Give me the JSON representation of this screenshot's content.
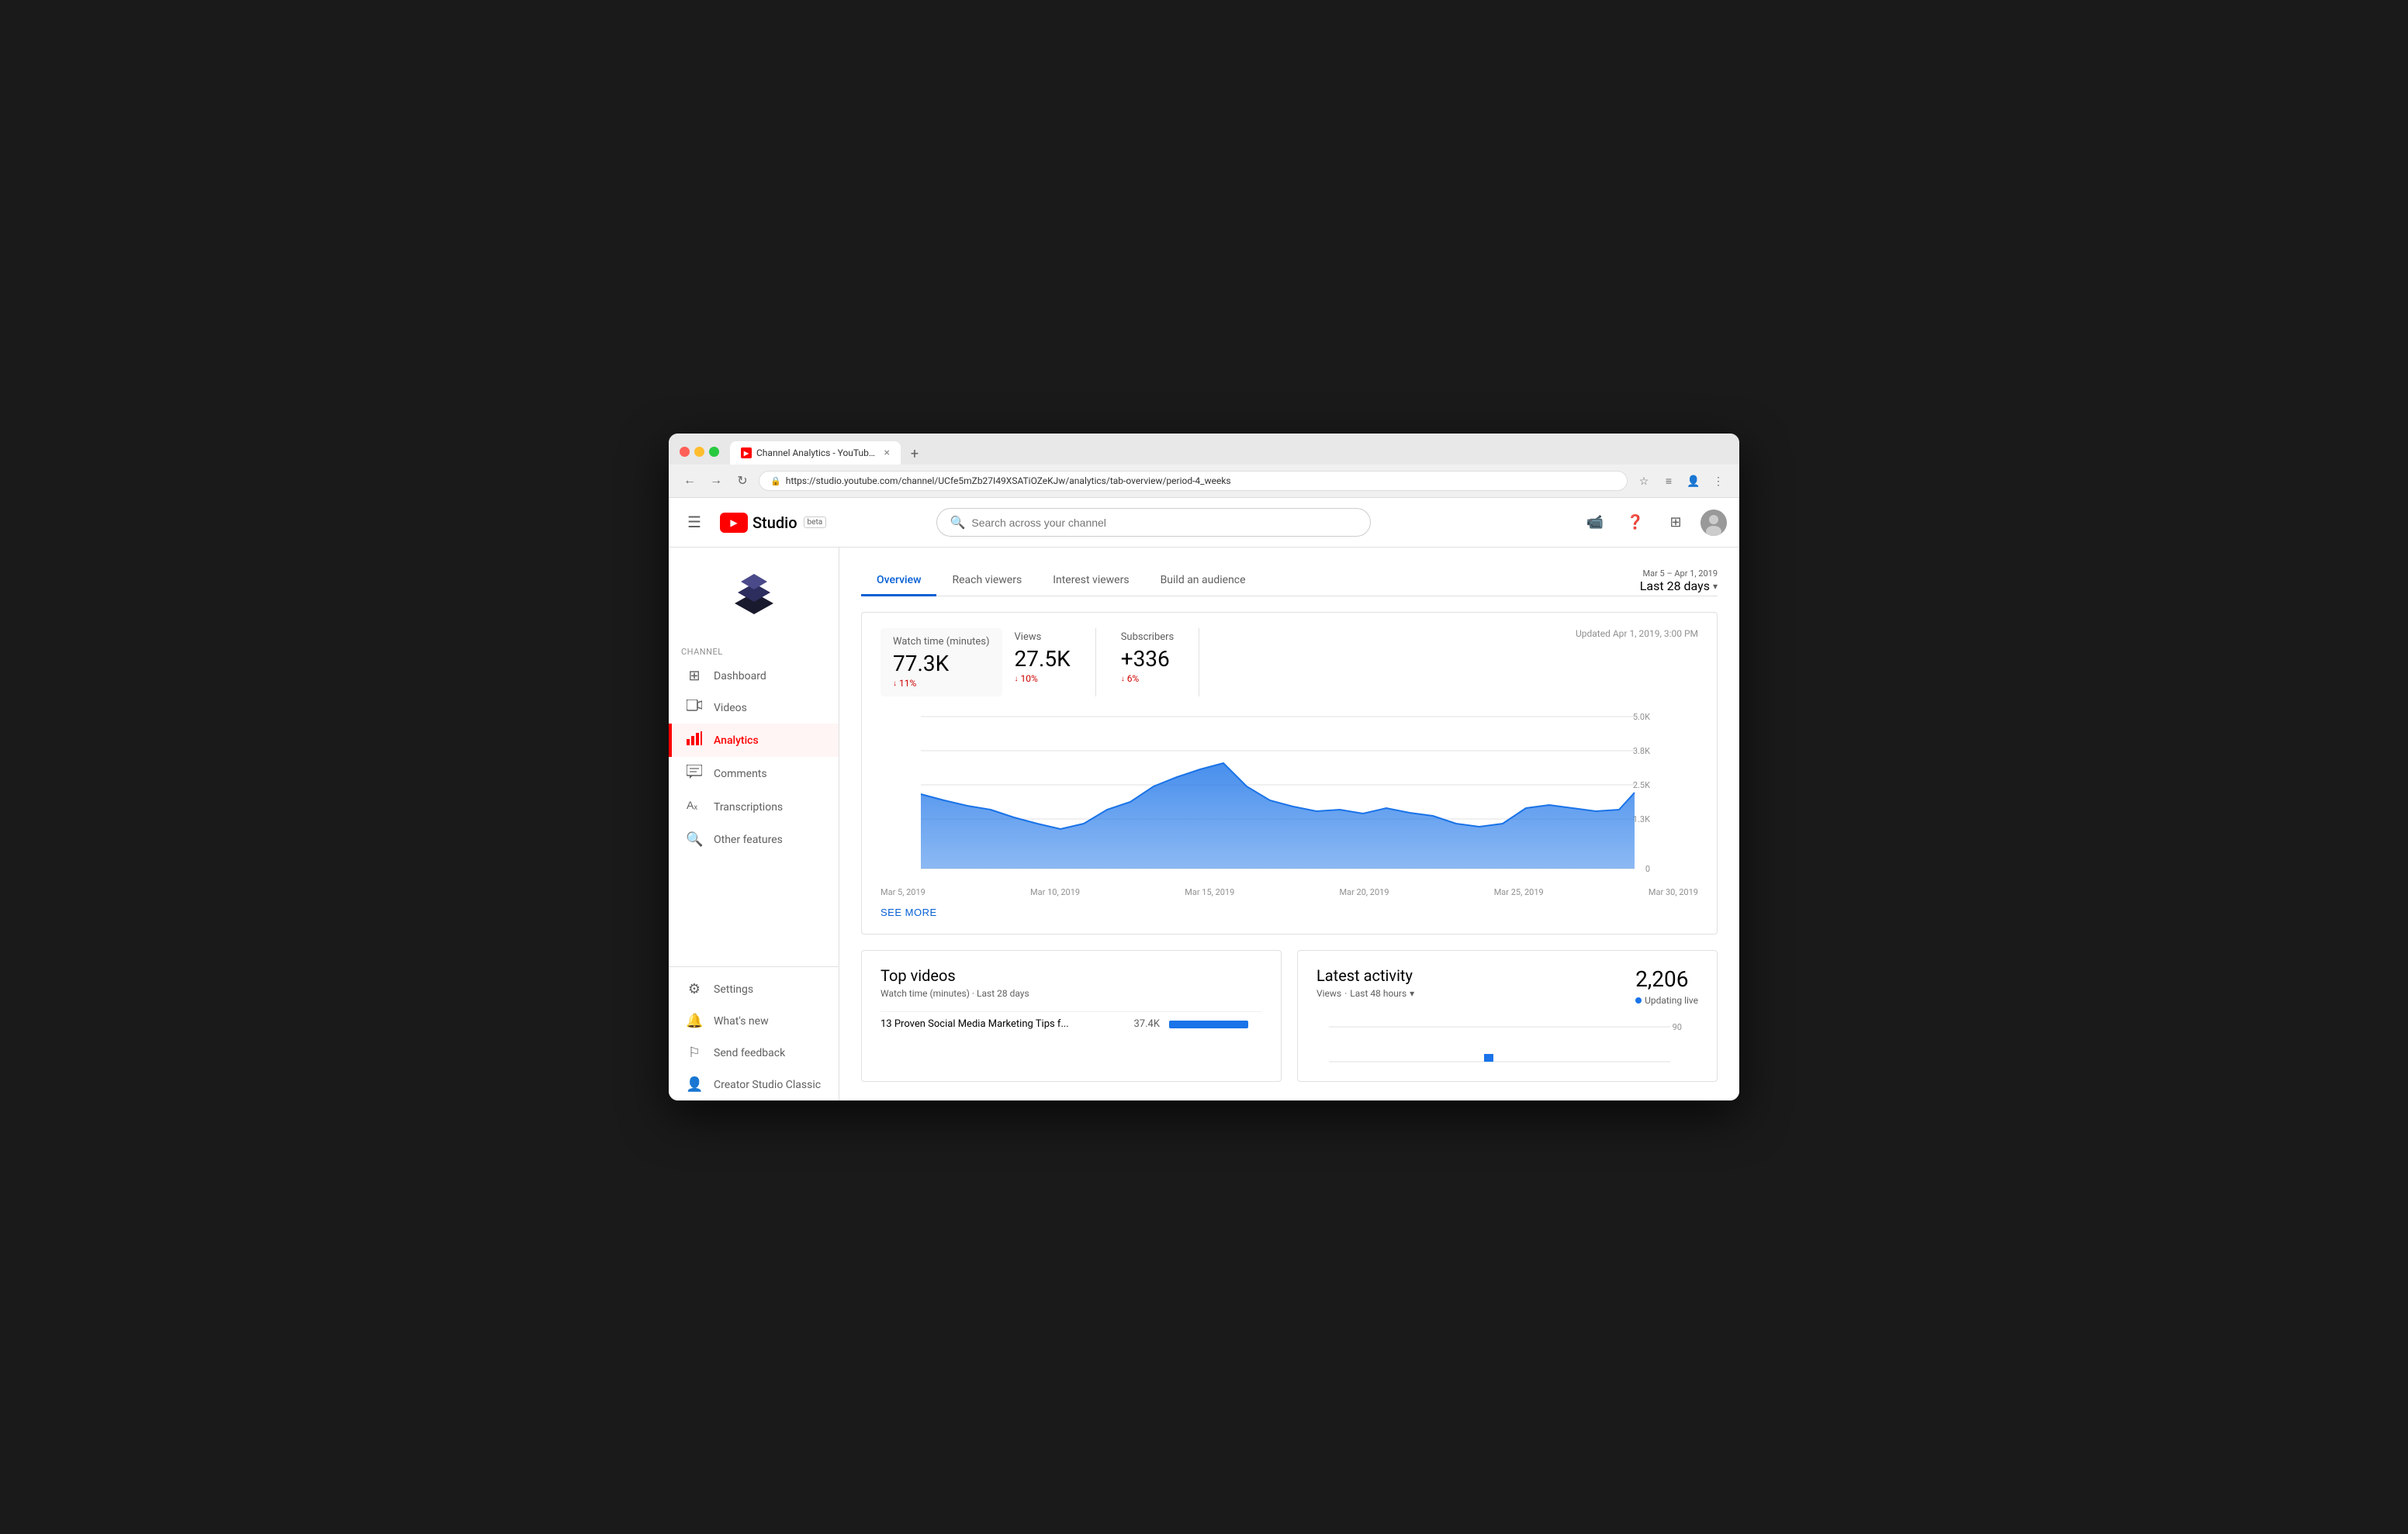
{
  "browser": {
    "tab_title": "Channel Analytics - YouTube S",
    "url": "https://studio.youtube.com/channel/UCfe5mZb27I49XSATiOZeKJw/analytics/tab-overview/period-4_weeks",
    "favicon_label": "YT"
  },
  "header": {
    "logo_text": "Studio",
    "beta_label": "beta",
    "search_placeholder": "Search across your channel",
    "page_title": "Channel Analytics - YouTube"
  },
  "sidebar": {
    "channel_label": "Channel",
    "items": [
      {
        "id": "dashboard",
        "label": "Dashboard",
        "icon": "⊞"
      },
      {
        "id": "videos",
        "label": "Videos",
        "icon": "▶"
      },
      {
        "id": "analytics",
        "label": "Analytics",
        "icon": "📊"
      },
      {
        "id": "comments",
        "label": "Comments",
        "icon": "💬"
      },
      {
        "id": "transcriptions",
        "label": "Transcriptions",
        "icon": "Aₓ"
      },
      {
        "id": "other-features",
        "label": "Other features",
        "icon": "🔍"
      }
    ],
    "bottom_items": [
      {
        "id": "settings",
        "label": "Settings",
        "icon": "⚙"
      },
      {
        "id": "whats-new",
        "label": "What's new",
        "icon": "🔔"
      },
      {
        "id": "send-feedback",
        "label": "Send feedback",
        "icon": "⚐"
      },
      {
        "id": "creator-studio",
        "label": "Creator Studio Classic",
        "icon": "👤"
      }
    ]
  },
  "analytics": {
    "page_title": "Channel Analytics",
    "breadcrumb": "Channel Analytics YouTube",
    "tabs": [
      {
        "id": "overview",
        "label": "Overview"
      },
      {
        "id": "reach-viewers",
        "label": "Reach viewers"
      },
      {
        "id": "interest-viewers",
        "label": "Interest viewers"
      },
      {
        "id": "build-audience",
        "label": "Build an audience"
      }
    ],
    "date_range": {
      "period": "Mar 5 – Apr 1, 2019",
      "label": "Last 28 days"
    },
    "stats": {
      "updated_text": "Updated Apr 1, 2019, 3:00 PM",
      "items": [
        {
          "label": "Watch time (minutes)",
          "value": "77.3K",
          "change": "11%",
          "direction": "down"
        },
        {
          "label": "Views",
          "value": "27.5K",
          "change": "10%",
          "direction": "down"
        },
        {
          "label": "Subscribers",
          "value": "+336",
          "change": "6%",
          "direction": "down"
        }
      ]
    },
    "chart": {
      "y_labels": [
        "5.0K",
        "3.8K",
        "2.5K",
        "1.3K",
        "0"
      ],
      "x_labels": [
        "Mar 5, 2019",
        "Mar 10, 2019",
        "Mar 15, 2019",
        "Mar 20, 2019",
        "Mar 25, 2019",
        "Mar 30, 2019"
      ],
      "see_more": "SEE MORE"
    },
    "top_videos": {
      "title": "Top videos",
      "subtitle": "Watch time (minutes) · Last 28 days",
      "items": [
        {
          "title": "13 Proven Social Media Marketing Tips f...",
          "views": "37.4K",
          "bar_pct": 85
        }
      ]
    },
    "latest_activity": {
      "title": "Latest activity",
      "subtitle_metric": "Views",
      "subtitle_period": "Last 48 hours",
      "count": "2,206",
      "live_label": "Updating live",
      "y_label": "90"
    }
  }
}
